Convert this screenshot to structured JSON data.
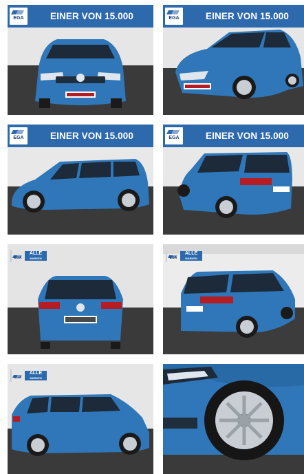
{
  "gallery": {
    "banner_text": "EINER VON 15.000",
    "logo_text": "EGA",
    "badge": {
      "line1": "ALLE",
      "line2": "MARKEN"
    },
    "tiles": [
      {
        "view": "front",
        "has_banner": true
      },
      {
        "view": "front-three-quarter",
        "has_banner": true
      },
      {
        "view": "side-left",
        "has_banner": true
      },
      {
        "view": "rear-three-quarter-left",
        "has_banner": true
      },
      {
        "view": "rear",
        "has_badge": true
      },
      {
        "view": "rear-three-quarter-right",
        "has_badge": true
      },
      {
        "view": "side-left-full",
        "has_badge": true
      },
      {
        "view": "wheel-closeup"
      }
    ]
  },
  "colors": {
    "banner": "#2d6aad",
    "car_body": "#2f77b8",
    "floor": "#3a3a3a",
    "wall": "#e9e9e9"
  },
  "icons": [
    "ega-logo-icon"
  ]
}
